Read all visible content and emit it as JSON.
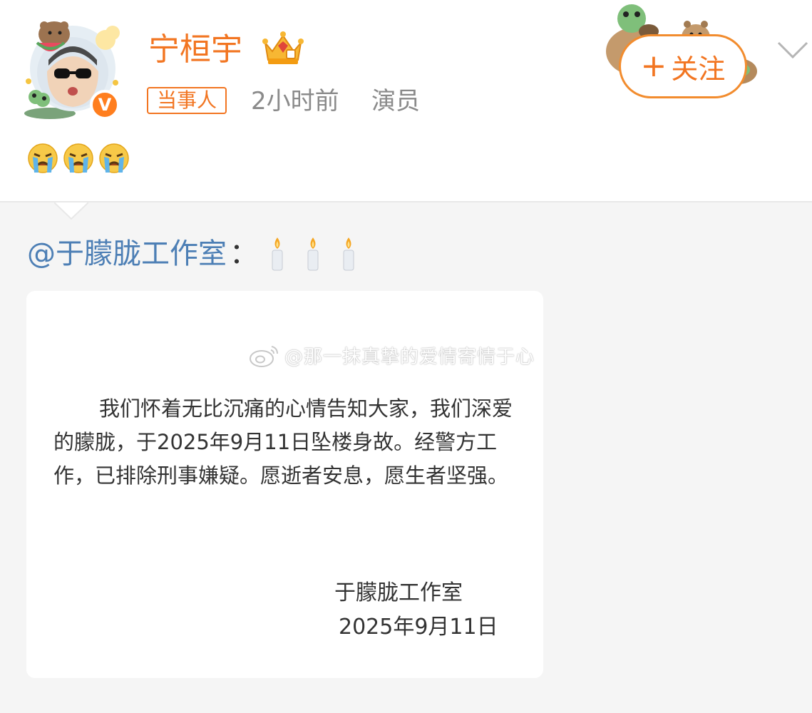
{
  "post": {
    "username": "宁桓宇",
    "tag": "当事人",
    "time": "2小时前",
    "role": "演员",
    "verified_mark": "V",
    "follow_label": "关注",
    "follow_plus": "+",
    "emojis": [
      "crying-emoji",
      "crying-emoji",
      "crying-emoji"
    ]
  },
  "repost": {
    "mention": "@于朦胧工作室",
    "colon": "：",
    "candles": [
      "candle-emoji",
      "candle-emoji",
      "candle-emoji"
    ],
    "image": {
      "watermark": "@那一抹真挚的爱情寄情于心",
      "body": "我们怀着无比沉痛的心情告知大家，我们深爱的朦胧，于2025年9月11日坠楼身故。经警方工作，已排除刑事嫌疑。愿逝者安息，愿生者坚强。",
      "signature": "于朦胧工作室",
      "date": "2025年9月11日"
    }
  },
  "colors": {
    "accent": "#f27521",
    "mention": "#4d7fb5",
    "meta": "#8a8a8a",
    "background": "#f5f5f5"
  }
}
